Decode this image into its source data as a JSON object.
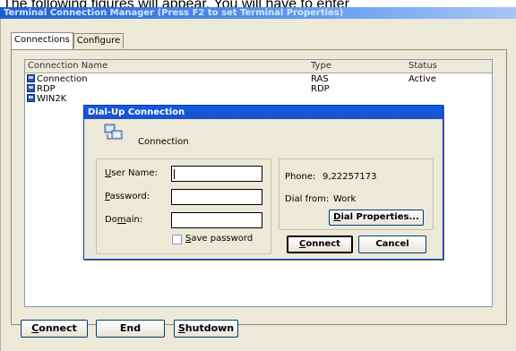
{
  "caption_text": "The following figures will appear. You will have to enter",
  "window": {
    "title": "Terminal Connection Manager (Press F2 to set Terminal Properties)"
  },
  "tabs": [
    {
      "label": "Connections"
    },
    {
      "label": "Configure"
    }
  ],
  "list": {
    "columns": [
      "Connection Name",
      "Type",
      "Status"
    ],
    "rows": [
      {
        "name": "Connection",
        "type": "RAS",
        "status": "Active"
      },
      {
        "name": "RDP",
        "type": "RDP",
        "status": ""
      },
      {
        "name": "WIN2K",
        "type": "",
        "status": ""
      }
    ]
  },
  "bottom_buttons": {
    "connect": {
      "accel": "C",
      "rest": "onnect"
    },
    "end": {
      "label": "End"
    },
    "shutdown": {
      "accel": "S",
      "rest": "hutdown"
    }
  },
  "dialog": {
    "title": "Dial-Up Connection",
    "connection_name": "Connection",
    "user_name": {
      "accel": "U",
      "rest": "ser Name:",
      "value": ""
    },
    "password": {
      "accel": "P",
      "rest": "assword:",
      "value": ""
    },
    "domain": {
      "pre": "Do",
      "accel": "m",
      "rest": "ain:",
      "value": ""
    },
    "save_password": {
      "accel": "S",
      "rest": "ave password",
      "checked": false
    },
    "phone_label": "Phone:",
    "phone_value": "9,22257173",
    "dial_from_label": "Dial from:",
    "dial_from_value": "Work",
    "dial_properties": {
      "accel": "D",
      "rest": "ial Properties..."
    },
    "connect": {
      "accel": "C",
      "rest": "onnect"
    },
    "cancel": {
      "label": "Cancel"
    }
  },
  "colors": {
    "titlebar": "#0a5ee0",
    "dialog_border": "#0831d9",
    "face": "#ece9d8"
  },
  "icons": {
    "row_icon": "monitor-icon",
    "dialog_icon": "dialup-connection-icon"
  }
}
